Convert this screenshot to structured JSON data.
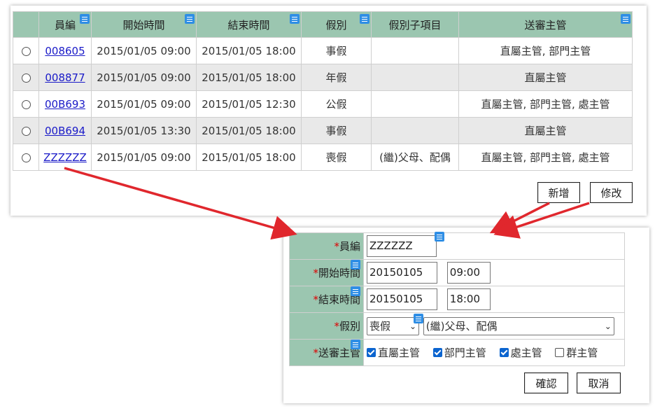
{
  "list": {
    "headers": [
      "",
      "員編",
      "開始時間",
      "結束時間",
      "假別",
      "假別子項目",
      "送審主管"
    ],
    "rows": [
      {
        "emp_id": "008605",
        "start": "2015/01/05 09:00",
        "end": "2015/01/05 18:00",
        "leave_type": "事假",
        "sub_item": "",
        "approvers": "直屬主管, 部門主管"
      },
      {
        "emp_id": "008877",
        "start": "2015/01/05 09:00",
        "end": "2015/01/05 18:00",
        "leave_type": "年假",
        "sub_item": "",
        "approvers": "直屬主管"
      },
      {
        "emp_id": "00B693",
        "start": "2015/01/05 09:00",
        "end": "2015/01/05 12:30",
        "leave_type": "公假",
        "sub_item": "",
        "approvers": "直屬主管, 部門主管, 處主管"
      },
      {
        "emp_id": "00B694",
        "start": "2015/01/05 13:30",
        "end": "2015/01/05 18:00",
        "leave_type": "事假",
        "sub_item": "",
        "approvers": "直屬主管"
      },
      {
        "emp_id": "ZZZZZZ",
        "start": "2015/01/05 09:00",
        "end": "2015/01/05 18:00",
        "leave_type": "喪假",
        "sub_item": "(繼)父母、配偶",
        "approvers": "直屬主管, 部門主管, 處主管"
      }
    ],
    "add_label": "新增",
    "edit_label": "修改"
  },
  "form": {
    "required_mark": "*",
    "emp_label": "員編",
    "emp_value": "ZZZZZZ",
    "start_label": "開始時間",
    "start_date": "20150105",
    "start_time": "09:00",
    "end_label": "結束時間",
    "end_date": "20150105",
    "end_time": "18:00",
    "leave_label": "假別",
    "leave_type": "喪假",
    "sub_item": "(繼)父母、配偶",
    "approver_label": "送審主管",
    "approvers": [
      {
        "label": "直屬主管",
        "checked": true
      },
      {
        "label": "部門主管",
        "checked": true
      },
      {
        "label": "處主管",
        "checked": true
      },
      {
        "label": "群主管",
        "checked": false
      }
    ],
    "confirm_label": "確認",
    "cancel_label": "取消"
  },
  "colors": {
    "header_bg": "#9bc6b0",
    "alt_row_bg": "#e9e9e9",
    "link": "#1a1ac8",
    "arrow": "#e0272d",
    "checkbox_on": "#0b64cf",
    "badge": "#2f8ee5"
  },
  "icons": [
    "list-badge-icon",
    "radio-icon",
    "checkbox-icon",
    "chevron-down-icon",
    "arrow-icon"
  ]
}
